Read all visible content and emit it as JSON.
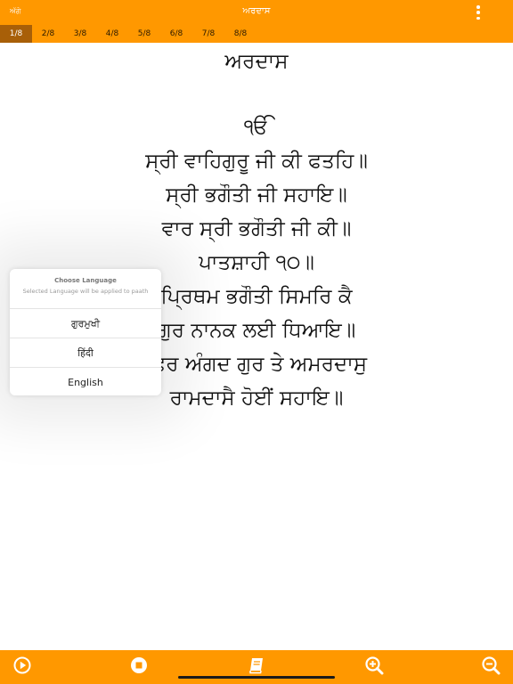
{
  "header": {
    "back_label": "ਅੱਗੇ",
    "title": "ਅਰਦਾਸ",
    "menu_icon": "more-vertical-icon"
  },
  "tabs": [
    "1/8",
    "2/8",
    "3/8",
    "4/8",
    "5/8",
    "6/8",
    "7/8",
    "8/8"
  ],
  "active_tab": "1/8",
  "content": {
    "heading": "ਅਰਦਾਸ",
    "lines": [
      "ੴ",
      "ਸ੍ਰੀ ਵਾਹਿਗੁਰੂ ਜੀ ਕੀ ਫਤਹਿ॥",
      "ਸ੍ਰੀ ਭਗੌਤੀ ਜੀ ਸਹਾਇ॥",
      "ਵਾਰ ਸ੍ਰੀ ਭਗੌਤੀ ਜੀ ਕੀ॥",
      "ਪਾਤਸ਼ਾਹੀ ੧੦॥",
      "ਪ੍ਰਿਥਮ ਭਗੌਤੀ ਸਿਮਰਿ ਕੈ",
      "ਗੁਰ ਨਾਨਕ ਲਈ ਧਿਆਇ॥",
      "ਫਿਰ ਅੰਗਦ ਗੁਰ ਤੇ ਅਮਰਦਾਸੁ",
      "ਰਾਮਦਾਸੈ ਹੋਈਂ ਸਹਾਇ॥"
    ]
  },
  "language_popover": {
    "title": "Choose Language",
    "subtitle": "Selected Language will be applied to paath",
    "options": [
      "ਗੁਰਮੁਖੀ",
      "हिंदी",
      "English"
    ]
  },
  "toolbar": {
    "icons": [
      "play-icon",
      "stop-icon",
      "book-icon",
      "zoom-in-icon",
      "zoom-out-icon"
    ]
  },
  "colors": {
    "accent": "#ff9800",
    "active_tab": "#a85f08",
    "icon": "#ffffff"
  }
}
